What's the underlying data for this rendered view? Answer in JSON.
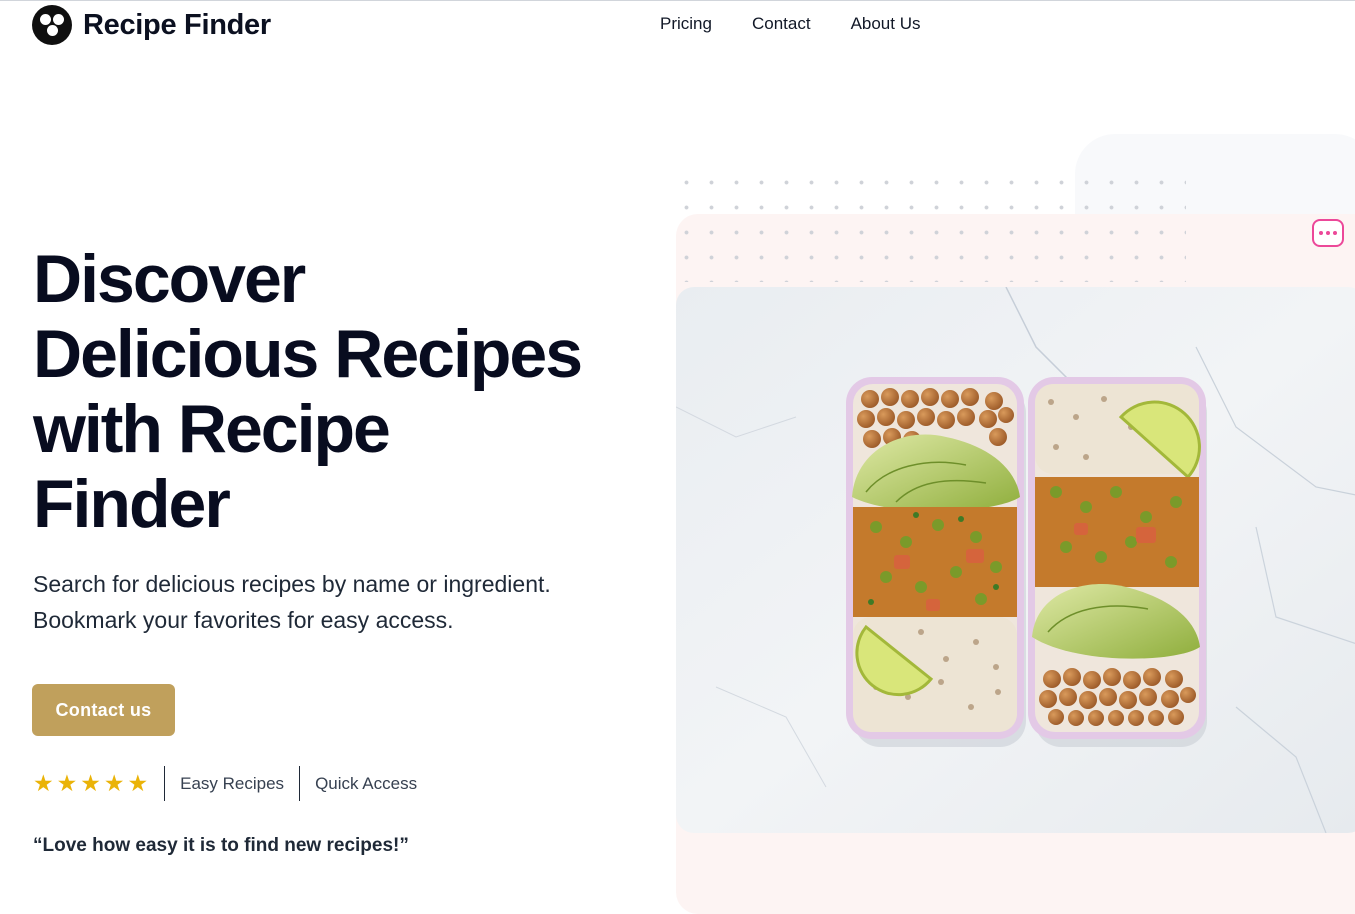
{
  "header": {
    "brand": "Recipe Finder",
    "nav": [
      "Pricing",
      "Contact",
      "About Us"
    ]
  },
  "hero": {
    "title": "Discover Delicious Recipes with Recipe Finder",
    "subtitle_line1": "Search for delicious recipes by name or ingredient.",
    "subtitle_line2": "Bookmark your favorites for easy access.",
    "cta_label": "Contact us",
    "rating_stars": 5,
    "features": [
      "Easy Recipes",
      "Quick Access"
    ],
    "testimonial": "“Love how easy it is to find new recipes!”"
  },
  "icons": {
    "logo": "three-dot-logo-icon",
    "more": "more-dots-icon",
    "star": "star-icon"
  },
  "colors": {
    "accent": "#c0a05c",
    "star": "#eab308",
    "more_button": "#ec4899",
    "heading": "#080c1f"
  }
}
